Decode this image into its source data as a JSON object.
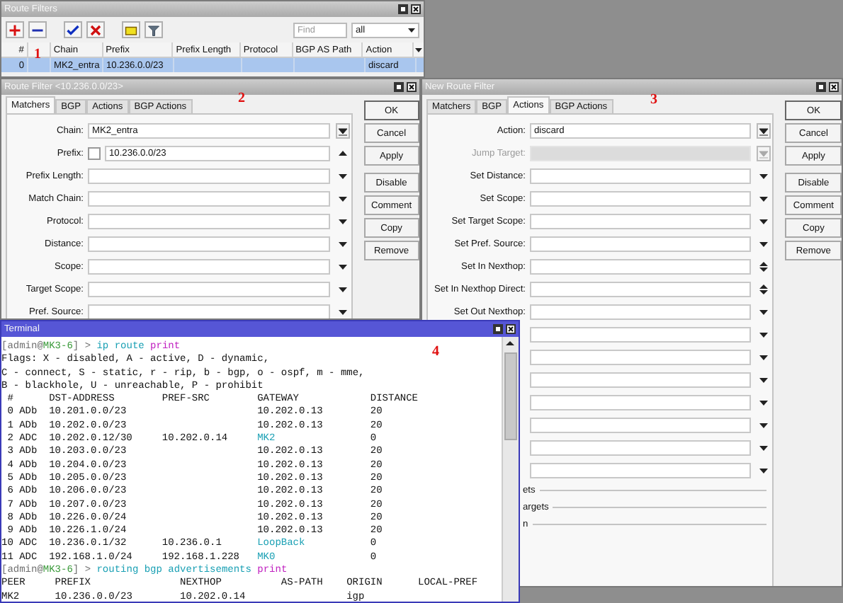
{
  "route_filters_window": {
    "title": "Route Filters",
    "marker": "1",
    "find": {
      "placeholder": "Find"
    },
    "filter": {
      "value": "all"
    },
    "columns": [
      "#",
      "Chain",
      "Prefix",
      "Prefix Length",
      "Protocol",
      "BGP AS Path",
      "Action"
    ],
    "rows": [
      {
        "num": "0",
        "chain": "MK2_entra",
        "prefix": "10.236.0.0/23",
        "action": "discard",
        "selected": true
      }
    ]
  },
  "route_filter_window": {
    "title": "Route Filter <10.236.0.0/23>",
    "marker": "2",
    "tabs": [
      {
        "label": "Matchers",
        "selected": true
      },
      {
        "label": "BGP",
        "selected": false
      },
      {
        "label": "Actions",
        "selected": false
      },
      {
        "label": "BGP Actions",
        "selected": false
      }
    ],
    "fields": [
      {
        "label": "Chain:",
        "value": "MK2_entra",
        "kind": "combo",
        "disabled": false
      },
      {
        "label": "Prefix:",
        "value": "10.236.0.0/23",
        "kind": "checked_value",
        "checked": false,
        "disabled": false
      },
      {
        "label": "Prefix Length:",
        "kind": "dropdown",
        "disabled": false
      },
      {
        "label": "Match Chain:",
        "kind": "dropdown",
        "disabled": false
      },
      {
        "label": "Protocol:",
        "kind": "dropdown",
        "disabled": false
      },
      {
        "label": "Distance:",
        "kind": "dropdown",
        "disabled": false
      },
      {
        "label": "Scope:",
        "kind": "dropdown",
        "disabled": false
      },
      {
        "label": "Target Scope:",
        "kind": "dropdown",
        "disabled": false
      },
      {
        "label": "Pref. Source:",
        "kind": "dropdown",
        "disabled": false
      }
    ],
    "buttons": [
      "OK",
      "Cancel",
      "Apply",
      "Disable",
      "Comment",
      "Copy",
      "Remove"
    ]
  },
  "new_route_filter_window": {
    "title": "New Route Filter",
    "marker": "3",
    "tabs": [
      {
        "label": "Matchers",
        "selected": false
      },
      {
        "label": "BGP",
        "selected": false
      },
      {
        "label": "Actions",
        "selected": true
      },
      {
        "label": "BGP Actions",
        "selected": false
      }
    ],
    "fields": [
      {
        "label": "Action:",
        "value": "discard",
        "kind": "combo",
        "disabled": false
      },
      {
        "label": "Jump Target:",
        "kind": "combo",
        "disabled": true
      },
      {
        "label": "Set Distance:",
        "kind": "dropdown",
        "disabled": false
      },
      {
        "label": "Set Scope:",
        "kind": "dropdown",
        "disabled": false
      },
      {
        "label": "Set Target Scope:",
        "kind": "dropdown",
        "disabled": false
      },
      {
        "label": "Set Pref. Source:",
        "kind": "dropdown",
        "disabled": false
      },
      {
        "label": "Set In Nexthop:",
        "kind": "spinner",
        "disabled": false
      },
      {
        "label": "Set In Nexthop Direct:",
        "kind": "spinner",
        "disabled": false
      },
      {
        "label": "Set Out Nexthop:",
        "kind": "dropdown",
        "disabled": false
      },
      {
        "kind": "dropdown",
        "disabled": false
      },
      {
        "kind": "dropdown",
        "disabled": false
      },
      {
        "kind": "dropdown",
        "disabled": false
      },
      {
        "kind": "dropdown",
        "disabled": false
      },
      {
        "kind": "dropdown",
        "disabled": false
      },
      {
        "kind": "dropdown",
        "disabled": false
      },
      {
        "kind": "dropdown",
        "disabled": false
      }
    ],
    "sections": [
      "ets",
      "argets",
      "n"
    ],
    "buttons": [
      "OK",
      "Cancel",
      "Apply",
      "Disable",
      "Comment",
      "Copy",
      "Remove"
    ]
  },
  "terminal": {
    "title": "Terminal",
    "marker": "4",
    "lines": [
      {
        "kind": "prompt",
        "user": "[admin@",
        "host": "MK3-6",
        "sep": "] >",
        "command": "ip route",
        "verb": "print"
      },
      {
        "kind": "text",
        "text": "Flags: X - disabled, A - active, D - dynamic,"
      },
      {
        "kind": "text",
        "text": "C - connect, S - static, r - rip, b - bgp, o - ospf, m - mme,"
      },
      {
        "kind": "text",
        "text": "B - blackhole, U - unreachable, P - prohibit"
      },
      {
        "kind": "route_header",
        "cells": [
          "#",
          "DST-ADDRESS",
          "PREF-SRC",
          "GATEWAY",
          "DISTANCE"
        ]
      },
      {
        "kind": "route",
        "num": "0",
        "flags": "ADb",
        "dst": "10.201.0.0/23",
        "gateway": "10.202.0.13",
        "interface": false,
        "distance": "20"
      },
      {
        "kind": "route",
        "num": "1",
        "flags": "ADb",
        "dst": "10.202.0.0/23",
        "gateway": "10.202.0.13",
        "interface": false,
        "distance": "20"
      },
      {
        "kind": "route",
        "num": "2",
        "flags": "ADC",
        "dst": "10.202.0.12/30",
        "pref_src": "10.202.0.14",
        "gateway": "MK2",
        "interface": true,
        "distance": "0"
      },
      {
        "kind": "route",
        "num": "3",
        "flags": "ADb",
        "dst": "10.203.0.0/23",
        "gateway": "10.202.0.13",
        "interface": false,
        "distance": "20"
      },
      {
        "kind": "route",
        "num": "4",
        "flags": "ADb",
        "dst": "10.204.0.0/23",
        "gateway": "10.202.0.13",
        "interface": false,
        "distance": "20"
      },
      {
        "kind": "route",
        "num": "5",
        "flags": "ADb",
        "dst": "10.205.0.0/23",
        "gateway": "10.202.0.13",
        "interface": false,
        "distance": "20"
      },
      {
        "kind": "route",
        "num": "6",
        "flags": "ADb",
        "dst": "10.206.0.0/23",
        "gateway": "10.202.0.13",
        "interface": false,
        "distance": "20"
      },
      {
        "kind": "route",
        "num": "7",
        "flags": "ADb",
        "dst": "10.207.0.0/23",
        "gateway": "10.202.0.13",
        "interface": false,
        "distance": "20"
      },
      {
        "kind": "route",
        "num": "8",
        "flags": "ADb",
        "dst": "10.226.0.0/24",
        "gateway": "10.202.0.13",
        "interface": false,
        "distance": "20"
      },
      {
        "kind": "route",
        "num": "9",
        "flags": "ADb",
        "dst": "10.226.1.0/24",
        "gateway": "10.202.0.13",
        "interface": false,
        "distance": "20"
      },
      {
        "kind": "route",
        "num": "10",
        "flags": "ADC",
        "dst": "10.236.0.1/32",
        "pref_src": "10.236.0.1",
        "gateway": "LoopBack",
        "interface": true,
        "distance": "0"
      },
      {
        "kind": "route",
        "num": "11",
        "flags": "ADC",
        "dst": "192.168.1.0/24",
        "pref_src": "192.168.1.228",
        "gateway": "MK0",
        "interface": true,
        "distance": "0"
      },
      {
        "kind": "prompt",
        "user": "[admin@",
        "host": "MK3-6",
        "sep": "] >",
        "command": "routing bgp advertisements",
        "verb": "print"
      },
      {
        "kind": "bgp_header",
        "cells": [
          "PEER",
          "PREFIX",
          "NEXTHOP",
          "AS-PATH",
          "ORIGIN",
          "LOCAL-PREF"
        ]
      },
      {
        "kind": "bgp_row",
        "peer": "MK2",
        "prefix": "10.236.0.0/23",
        "nexthop": "10.202.0.14",
        "origin": "igp"
      }
    ]
  }
}
